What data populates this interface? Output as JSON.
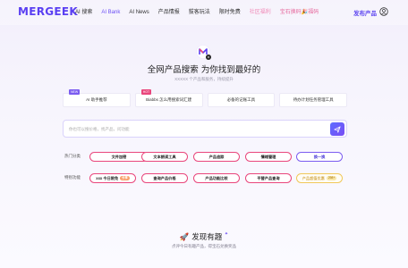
{
  "header": {
    "logo": "MERGEEK",
    "nav": [
      {
        "label": "AI 搜索",
        "style": "normal"
      },
      {
        "label": "AI Bank",
        "style": "active"
      },
      {
        "label": "AI News",
        "style": "normal"
      },
      {
        "label": "产品情报",
        "style": "normal"
      },
      {
        "label": "拔客玩法",
        "style": "normal"
      },
      {
        "label": "限时免费",
        "style": "normal"
      },
      {
        "label": "社区福利",
        "style": "pink"
      },
      {
        "label": "宝石换码🎉福码",
        "style": "pink2"
      }
    ],
    "publish": "发布产品",
    "user_icon": "user-circle-icon"
  },
  "hero": {
    "title": "全网产品搜索 为你找到最好的",
    "subtitle": "XXXXX 个产品和服务，持续提升"
  },
  "cards": [
    {
      "label": "AI 助手推荐",
      "tag": "NEW",
      "tag_color": "#7b5cf0"
    },
    {
      "label": "Biabbs 怎么用搜索词汇建",
      "tag": "HOT",
      "tag_color": "#e9467c"
    },
    {
      "label": "必备的记账工具",
      "tag": "",
      "tag_color": ""
    },
    {
      "label": "待办计划任务管理工具",
      "tag": "",
      "tag_color": ""
    }
  ],
  "search": {
    "placeholder": "你也可以搜价格，找产品，问功能"
  },
  "hot_categories": {
    "label": "热门分类",
    "items": [
      "文件加密",
      "文本朗读工具",
      "产品追踪",
      "情绪管理",
      "换一换"
    ]
  },
  "special_features": {
    "label": "特别功能",
    "items": [
      {
        "label": "xxx 今日限免",
        "badge": "分享",
        "badge_color": "#f8a06a"
      },
      {
        "label": "查询产品价格",
        "badge": "",
        "badge_color": ""
      },
      {
        "label": "产品功能比较",
        "badge": "",
        "badge_color": ""
      },
      {
        "label": "平替产品查询",
        "badge": "",
        "badge_color": ""
      },
      {
        "label": "产品超值优惠",
        "badge": "298+",
        "badge_color": "#f0c85a"
      }
    ]
  },
  "discover": {
    "title": "发现有趣",
    "subtitle": "点评今日有趣产品，得宝石兑换奖品"
  },
  "colors": {
    "accent": "#6b4ff5",
    "pink": "#e9467c"
  }
}
